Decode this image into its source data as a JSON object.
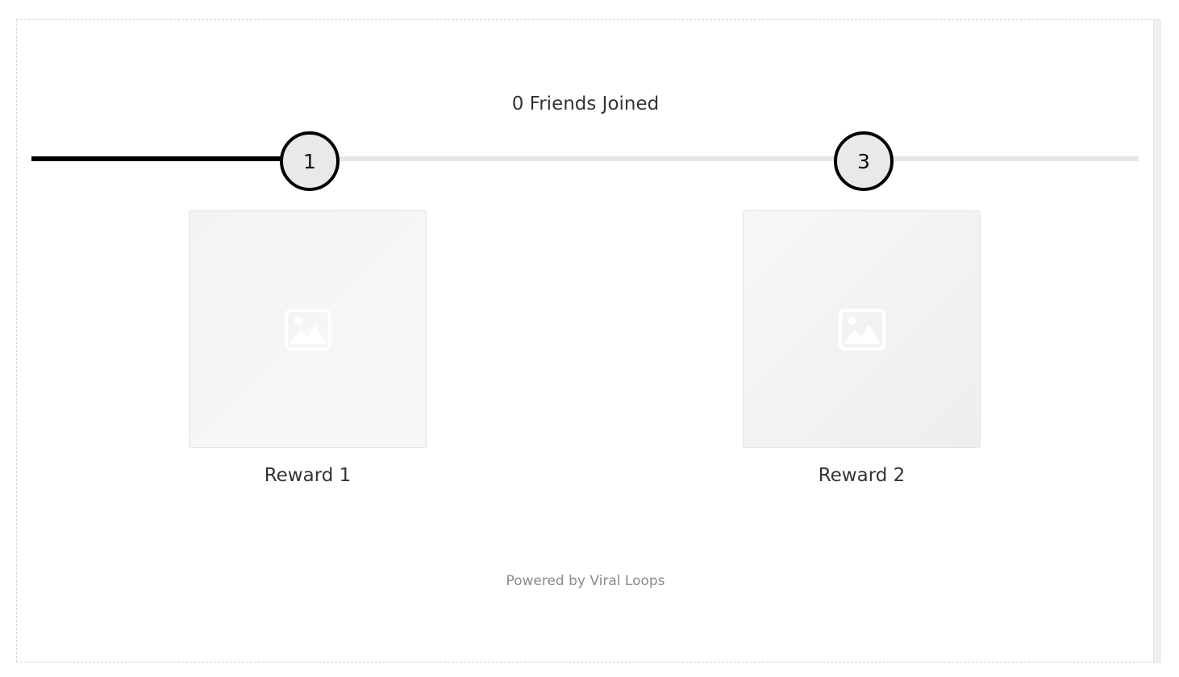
{
  "widget": {
    "friends_joined": "0 Friends Joined",
    "progress_fraction": 0.25,
    "milestones": [
      {
        "label": "1"
      },
      {
        "label": "3"
      }
    ],
    "rewards": [
      {
        "label": "Reward 1",
        "image_icon": "image-placeholder-icon"
      },
      {
        "label": "Reward 2",
        "image_icon": "image-placeholder-icon"
      }
    ],
    "powered_by": "Powered by Viral Loops"
  },
  "colors": {
    "track": "#e6e6e6",
    "track_fill": "#000000",
    "milestone_bg": "#e9e9e9",
    "milestone_border": "#000000",
    "text": "#333333",
    "muted_text": "#8a8a8a"
  }
}
